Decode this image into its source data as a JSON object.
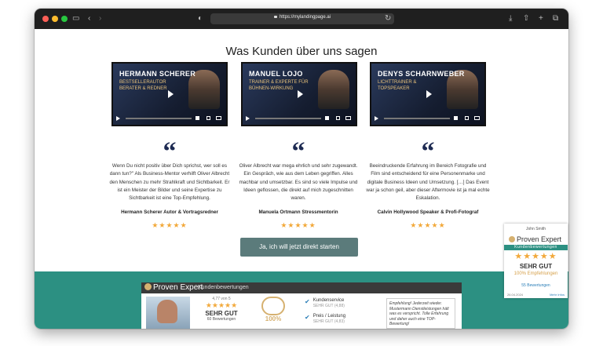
{
  "browser": {
    "url": "https://mylandingpage.ai",
    "icons": [
      "sidebar-icon",
      "back-icon",
      "forward-icon",
      "shield-icon",
      "lock-icon",
      "reload-icon",
      "download-icon",
      "share-icon",
      "new-tab-icon",
      "tabs-icon"
    ]
  },
  "page": {
    "heading": "Was Kunden über uns sagen",
    "videos": [
      {
        "name": "HERMANN SCHERER",
        "subtitle": "BESTSELLERAUTOR BERATER & REDNER"
      },
      {
        "name": "MANUEL LOJO",
        "subtitle": "TRAINER & EXPERTE FÜR BÜHNEN-WIRKUNG"
      },
      {
        "name": "DENYS SCHARNWEBER",
        "subtitle": "LICHTTRAINER & TOPSPEAKER"
      }
    ],
    "testimonials": [
      {
        "text": "Wenn Du nicht positiv über Dich sprichst, wer soll es dann tun?\" Als Business-Mentor verhilft Oliver Albrecht den Menschen zu mehr Strahlkraft und Sichtbarkeit. Er ist ein Meister der Bilder und seine Expertise zu Sichtbarkeit ist eine Top-Empfehlung.",
        "author": "Hermann Scherer Autor & Vortragsredner",
        "stars": "★★★★★"
      },
      {
        "text": "Oliver Albrecht war mega ehrlich und sehr zugewandt. Ein Gespräch, wie aus dem Leben gegriffen. Alles machbar und umsetzbar. Es sind so viele Impulse und Ideen geflossen, die direkt auf mich zugeschnitten waren.",
        "author": "Manuela Ortmann Stressmentorin",
        "stars": "★★★★★"
      },
      {
        "text": "Beeindruckende Erfahrung im Bereich Fotografie und Film sind entscheidend für eine Personenmarke und digitale Business Ideen und Umsetzung. […] Das Event war ja schon geil, aber dieser Aftermovie ist ja mal echte Eskalation.",
        "author": "Calvin Hollywood Speaker & Profi-Fotograf",
        "stars": "★★★★★"
      }
    ],
    "quote_mark": "“",
    "cta_label": "Ja, ich will jetzt direkt starten"
  },
  "provenexpert_banner": {
    "logo": "Proven Expert",
    "subtitle": "Kundenbewertungen",
    "score_small": "4,77 von 5",
    "stars": "★★★★★",
    "grade": "SEHR GUT",
    "count": "60 Bewertungen",
    "recommend_pct": "100%",
    "criteria": [
      {
        "label": "Kundenservice",
        "value": "SEHR GUT (4,88)"
      },
      {
        "label": "Preis / Leistung",
        "value": "SEHR GUT (4,83)"
      }
    ],
    "note": "Empfehlung! Jederzeit wieder. Mustermann Dienstleistungen hält was es verspricht. Tolle Erfahrung und daher auch eine TOP-Bewertung!"
  },
  "provenexpert_widget": {
    "name": "John Smith",
    "logo": "Proven Expert",
    "band": "Kundenbewertungen",
    "stars": "★★★★★",
    "grade": "SEHR GUT",
    "recommend": "100% Empfehlungen",
    "count": "55 Bewertungen",
    "date": "26.04.2024",
    "more": "Mehr Infos"
  }
}
